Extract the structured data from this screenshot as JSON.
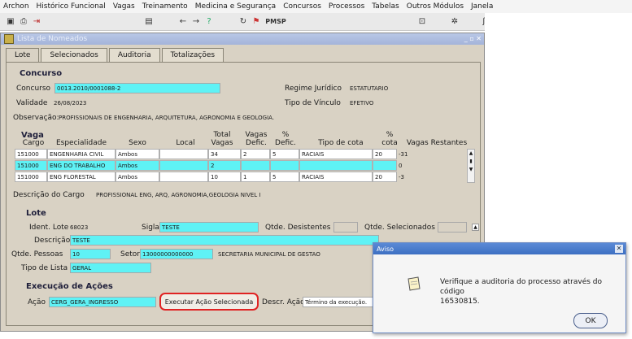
{
  "menu": [
    "Archon",
    "Histórico Funcional",
    "Vagas",
    "Treinamento",
    "Medicina e Segurança",
    "Concursos",
    "Processos",
    "Tabelas",
    "Outros Módulos",
    "Janela"
  ],
  "toolbar": {
    "pmsp_label": "PMSP"
  },
  "window": {
    "title": "Lista de Nomeados"
  },
  "tabs": [
    "Lote",
    "Selecionados",
    "Auditoria",
    "Totalizações"
  ],
  "concurso": {
    "section": "Concurso",
    "label": "Concurso",
    "value": "0013.2010/0001088-2",
    "regime_label": "Regime Jurídico",
    "regime_value": "ESTATUTARIO",
    "validade_label": "Validade",
    "validade_value": "26/08/2023",
    "vinculo_label": "Tipo de Vínculo",
    "vinculo_value": "EFETIVO",
    "obs_label": "Observação:",
    "obs_value": "PROFISSIONAIS DE ENGENHARIA, ARQUITETURA, AGRONOMIA E GEOLOGIA."
  },
  "vaga": {
    "section": "Vaga",
    "headers": {
      "cargo": "Cargo",
      "especialidade": "Especialidade",
      "sexo": "Sexo",
      "local": "Local",
      "total": [
        "Total",
        "Vagas"
      ],
      "vagas_defic": [
        "Vagas",
        "Defic."
      ],
      "pct_defic": [
        "%",
        "Defic."
      ],
      "tipo_cota": "Tipo de cota",
      "pct_cota": [
        "%",
        "cota"
      ],
      "restantes": "Vagas Restantes"
    },
    "rows": [
      [
        "151000",
        "ENGENHARIA CIVIL",
        "Ambos",
        "",
        "34",
        "2",
        "5",
        "RACIAIS",
        "20",
        "-31"
      ],
      [
        "151000",
        "ENG DO TRABALHO",
        "Ambos",
        "",
        "2",
        "",
        "",
        "",
        "",
        "0"
      ],
      [
        "151000",
        "ENG FLORESTAL",
        "Ambos",
        "",
        "10",
        "1",
        "5",
        "RACIAIS",
        "20",
        "-3"
      ]
    ],
    "desc_label": "Descrição do Cargo",
    "desc_value": "PROFISSIONAL ENG, ARQ, AGRONOMIA,GEOLOGIA NIVEL I"
  },
  "lote": {
    "section": "Lote",
    "ident_label": "Ident. Lote",
    "ident_value": "68023",
    "sigla_label": "Sigla",
    "sigla_value": "TESTE",
    "desist_label": "Qtde. Desistentes",
    "selec_label": "Qtde. Selecionados",
    "descricao_label": "Descrição",
    "descricao_value": "TESTE",
    "pessoas_label": "Qtde. Pessoas",
    "pessoas_value": "10",
    "setor_label": "Setor",
    "setor_code": "13000000000000",
    "setor_name": "SECRETARIA MUNICIPAL DE GESTAO",
    "tipo_label": "Tipo de Lista",
    "tipo_value": "GERAL"
  },
  "acoes": {
    "section": "Execução de Ações",
    "acao_label": "Ação",
    "acao_value": "CERG_GERA_INGRESSO",
    "exec_button": "Executar Ação Selecionada",
    "descr_label": "Descr. Ação",
    "descr_value": "Término da execução."
  },
  "dialog": {
    "title": "Aviso",
    "message_line1": "Verifique a auditoria do processo através do código",
    "message_line2": "16530815.",
    "ok": "OK"
  },
  "colors": {
    "highlight_field": "#5ff2f5",
    "panel": "#d9d2c4",
    "dialog_title": "#3d6fc2",
    "focus_ring": "#e02323"
  }
}
